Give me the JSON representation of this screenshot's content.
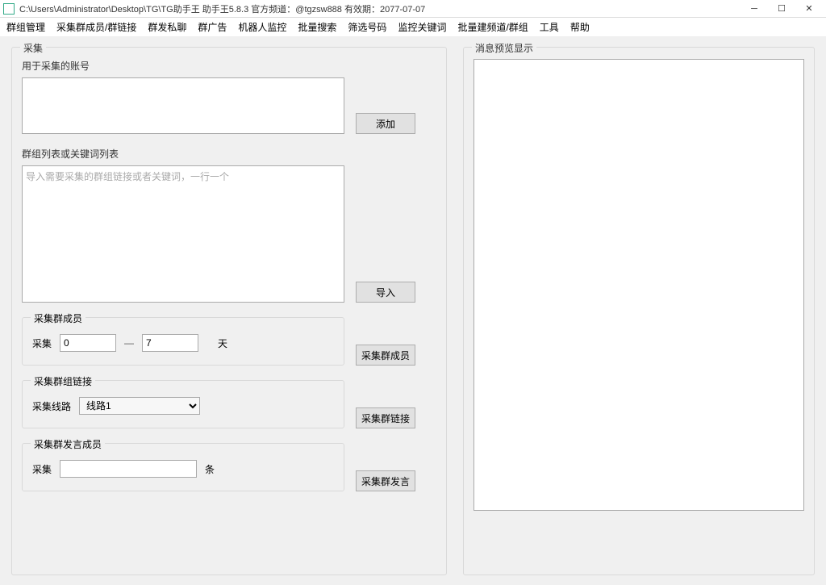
{
  "window": {
    "title": "C:\\Users\\Administrator\\Desktop\\TG\\TG助手王   助手王5.8.3  官方频道：@tgzsw888       有效期：2077-07-07"
  },
  "menu": {
    "items": [
      "群组管理",
      "采集群成员/群链接",
      "群发私聊",
      "群广告",
      "机器人监控",
      "批量搜索",
      "筛选号码",
      "监控关键词",
      "批量建频道/群组",
      "工具",
      "帮助"
    ]
  },
  "left": {
    "title": "采集",
    "account_label": "用于采集的账号",
    "add_btn": "添加",
    "groups_label": "群组列表或关键词列表",
    "groups_placeholder": "导入需要采集的群组链接或者关键词，一行一个",
    "import_btn": "导入",
    "collect_members": {
      "title": "采集群成员",
      "label_collect": "采集",
      "from": "0",
      "to": "7",
      "unit": "天",
      "btn": "采集群成员"
    },
    "collect_links": {
      "title": "采集群组链接",
      "label_route": "采集线路",
      "route_value": "线路1",
      "btn": "采集群链接"
    },
    "collect_speakers": {
      "title": "采集群发言成员",
      "label_collect": "采集",
      "count": "",
      "unit": "条",
      "btn": "采集群发言"
    }
  },
  "right": {
    "title": "消息预览显示"
  }
}
